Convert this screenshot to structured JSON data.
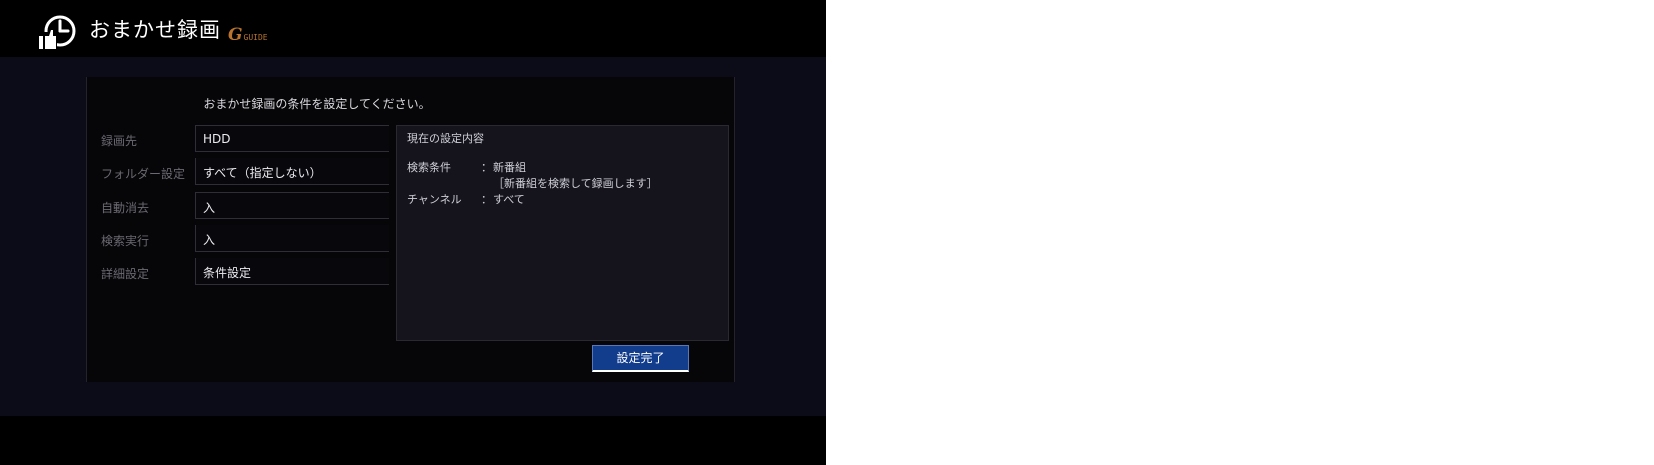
{
  "header": {
    "title": "おまかせ録画",
    "brand_logo_text": "G",
    "brand_logo_small": "GUIDE",
    "icon": "thumbs-up-clock-icon"
  },
  "instruction": "おまかせ録画の条件を設定してください。",
  "settings": [
    {
      "label": "録画先",
      "value": "HDD"
    },
    {
      "label": "フォルダー設定",
      "value": "すべて（指定しない）"
    },
    {
      "label": "自動消去",
      "value": "入"
    },
    {
      "label": "検索実行",
      "value": "入"
    },
    {
      "label": "詳細設定",
      "value": "条件設定"
    }
  ],
  "current_settings": {
    "title": "現在の設定内容",
    "rows": [
      {
        "key": "検索条件",
        "sep": "：",
        "value": "新番組"
      },
      {
        "key": "",
        "sep": "",
        "value": "［新番組を検索して録画します］"
      },
      {
        "key": "チャンネル",
        "sep": "：",
        "value": "すべて"
      }
    ]
  },
  "done_button": "設定完了",
  "colors": {
    "background": "#0c0b18",
    "panel": "#060508",
    "button": "#123c8c",
    "brand": "#b8732e"
  }
}
